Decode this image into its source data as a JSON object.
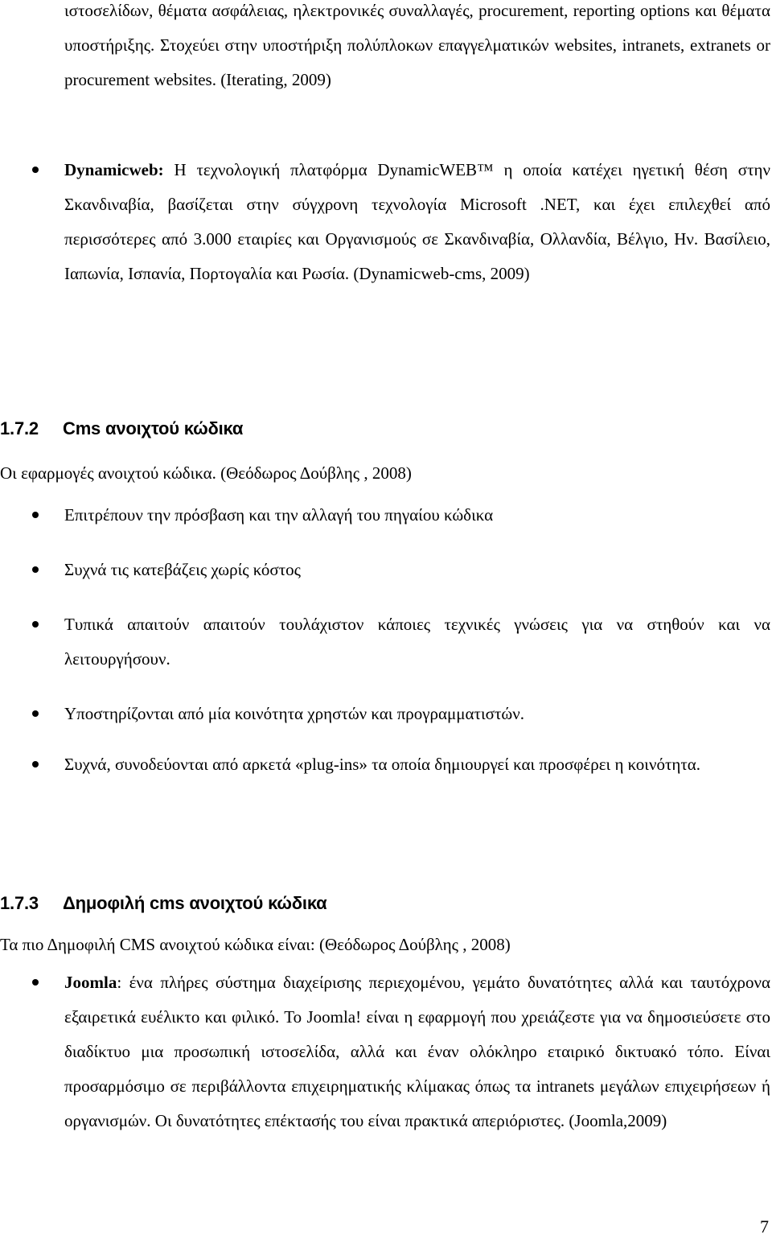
{
  "document": {
    "intro_paragraph": {
      "lines_text": "ιστοσελίδων, θέματα ασφάλειας, ηλεκτρονικές συναλλαγές, procurement, reporting options και θέματα υποστήριξης. Στοχεύει στην υποστήριξη πολύπλοκων επαγγελματικών websites, intranets, extranets or procurement websites. (Iterating, 2009)"
    },
    "dynamicweb_item": {
      "term": "Dynamicweb:",
      "text": " Η τεχνολογική πλατφόρμα DynamicWEB™ η οποία κατέχει ηγετική θέση στην Σκανδιναβία, βασίζεται στην σύγχρονη τεχνολογία Microsoft .NET, και έχει επιλεχθεί από περισσότερες από 3.000 εταιρίες και Οργανισμούς σε Σκανδιναβία, Ολλανδία, Βέλγιο, Ην. Βασίλειο, Ιαπωνία, Ισπανία, Πορτογαλία και Ρωσία. (Dynamicweb-cms, 2009)"
    },
    "section_172": {
      "number": "1.7.2",
      "title": "Cms ανοιχτού κώδικα",
      "intro": "Οι εφαρμογές ανοιχτού κώδικα. (Θεόδωρος Δούβλης , 2008)",
      "bullets": [
        "Επιτρέπουν την πρόσβαση και την αλλαγή του πηγαίου κώδικα",
        "Συχνά τις κατεβάζεις χωρίς κόστος",
        "Τυπικά απαιτούν απαιτούν τουλάχιστον κάποιες τεχνικές γνώσεις για να στηθούν και να λειτουργήσουν.",
        "Υποστηρίζονται από μία κοινότητα χρηστών και προγραμματιστών.",
        "Συχνά, συνοδεύονται από αρκετά «plug-ins» τα οποία δημιουργεί και προσφέρει η κοινότητα."
      ]
    },
    "section_173": {
      "number": "1.7.3",
      "title": "Δημοφιλή cms ανοιχτού κώδικα",
      "intro": "Τα πιο Δημοφιλή CMS ανοιχτού κώδικα είναι: (Θεόδωρος Δούβλης , 2008)",
      "joomla_item": {
        "term": "Joomla",
        "text": ": ένα πλήρες σύστημα διαχείρισης περιεχομένου, γεμάτο δυνατότητες αλλά και ταυτόχρονα εξαιρετικά ευέλικτο και φιλικό. Το Joomla! είναι η εφαρμογή που χρειάζεστε για να δημοσιεύσετε στο διαδίκτυο μια προσωπική ιστοσελίδα, αλλά και έναν ολόκληρο εταιρικό δικτυακό τόπο. Είναι προσαρμόσιμο σε περιβάλλοντα επιχειρηματικής κλίμακας όπως τα intranets μεγάλων επιχειρήσεων ή οργανισμών. Οι δυνατότητες επέκτασής του είναι πρακτικά απεριόριστες. (Joomla,2009)"
      }
    },
    "page_number": "7"
  }
}
